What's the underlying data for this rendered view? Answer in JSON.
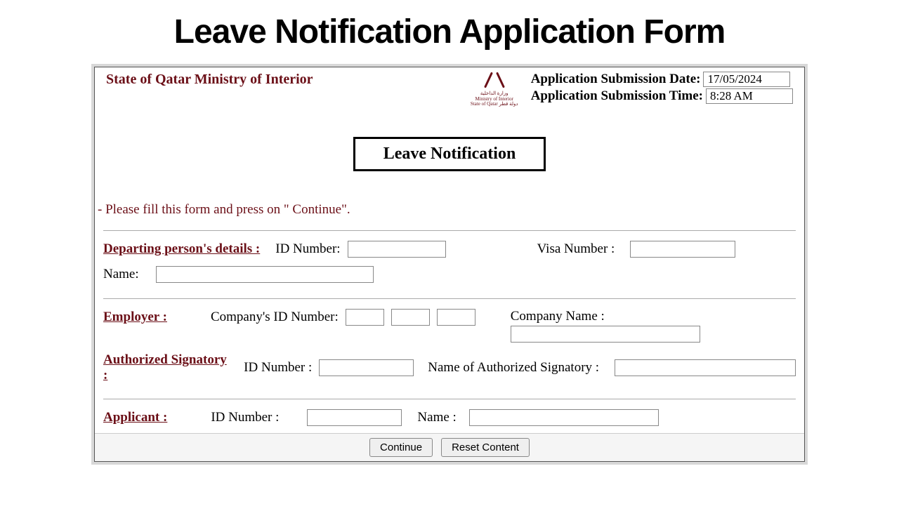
{
  "page": {
    "title": "Leave Notification Application Form"
  },
  "header": {
    "ministry": "State of Qatar Ministry of Interior",
    "logo": {
      "line1": "وزارة الداخلية",
      "line2": "Ministry of Interior",
      "line3": "State of Qatar دولة قطر"
    },
    "submission_date_label": "Application Submission Date:",
    "submission_date_value": "17/05/2024",
    "submission_time_label": "Application Submission Time:",
    "submission_time_value": "8:28 AM"
  },
  "form": {
    "title": "Leave Notification",
    "instruction": "- Please fill this form and press on \" Continue\".",
    "departing": {
      "section_label": " Departing person's details : ",
      "id_label": "ID Number:",
      "id_value": "",
      "visa_label": "Visa Number :",
      "visa_value": "",
      "name_label": "Name:",
      "name_value": ""
    },
    "employer": {
      "section_label": " Employer : ",
      "company_id_label": "Company's ID Number:",
      "company_id_1": "",
      "company_id_2": "",
      "company_id_3": "",
      "company_name_label": "Company Name :",
      "company_name_value": ""
    },
    "signatory": {
      "section_label": " Authorized Signatory : ",
      "id_label": "ID Number :",
      "id_value": "",
      "name_label": "Name of Authorized Signatory :",
      "name_value": ""
    },
    "applicant": {
      "section_label": " Applicant : ",
      "id_label": "ID Number :",
      "id_value": "",
      "name_label": "Name :",
      "name_value": ""
    },
    "buttons": {
      "continue": "Continue",
      "reset": "Reset Content"
    }
  }
}
